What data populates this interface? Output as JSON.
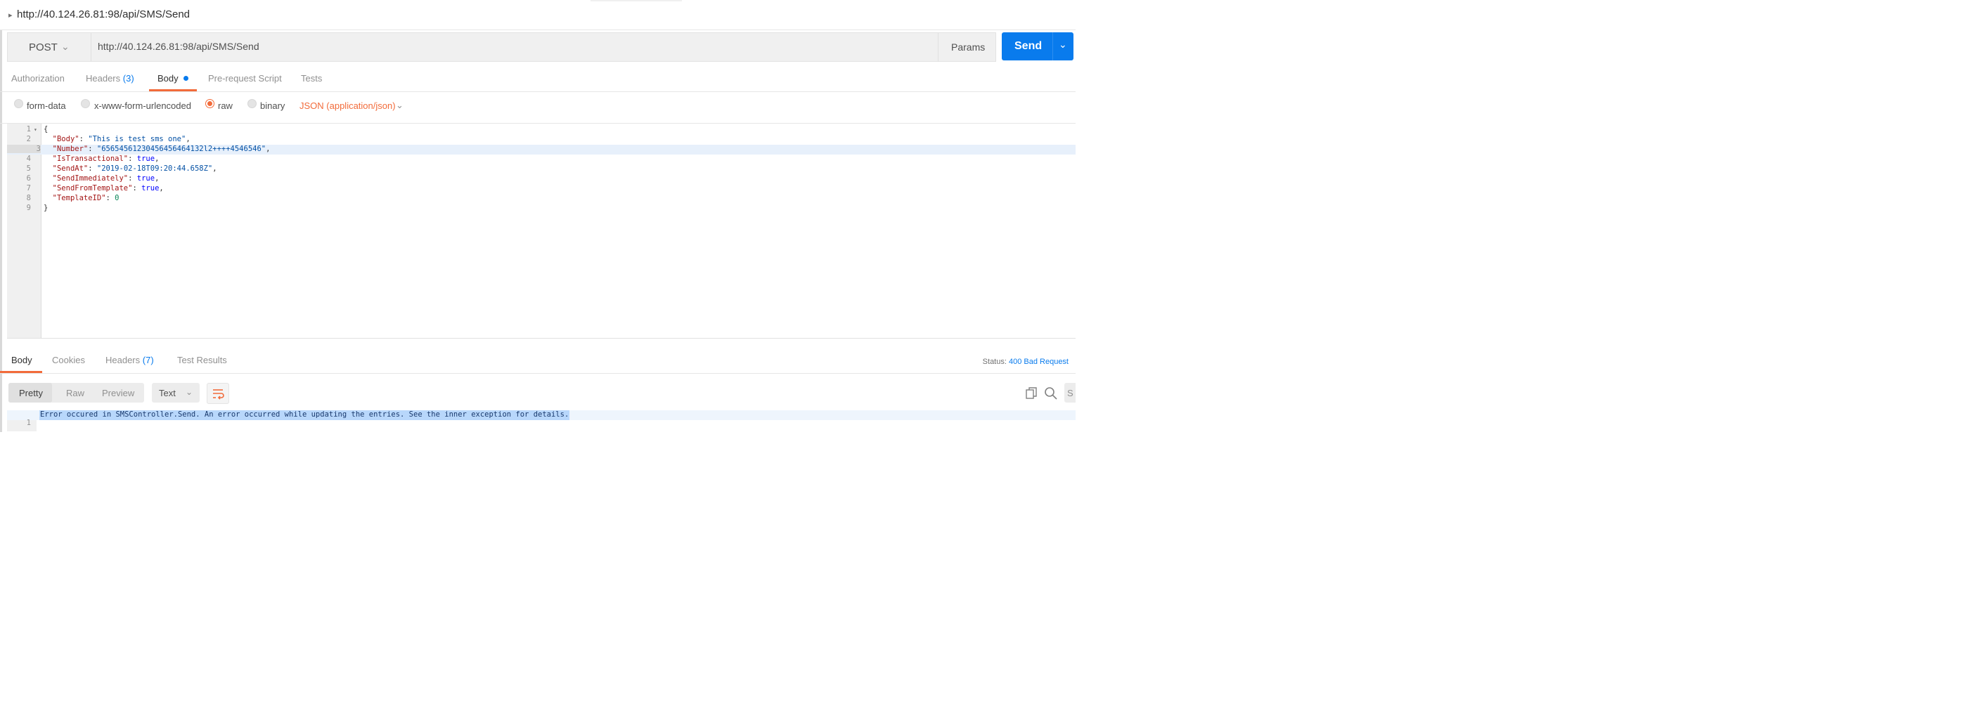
{
  "tab": {
    "title": "http://40.124.26.81:98/api/SMS/Send"
  },
  "request": {
    "method": "POST",
    "url": "http://40.124.26.81:98/api/SMS/Send",
    "params_label": "Params",
    "send_label": "Send"
  },
  "request_tabs": [
    {
      "label": "Authorization"
    },
    {
      "label": "Headers",
      "count": "(3)"
    },
    {
      "label": "Body"
    },
    {
      "label": "Pre-request Script"
    },
    {
      "label": "Tests"
    }
  ],
  "body_options": {
    "form_data": "form-data",
    "urlencoded": "x-www-form-urlencoded",
    "raw": "raw",
    "binary": "binary",
    "selected": "raw",
    "content_type": "JSON (application/json)"
  },
  "editor_lines": [
    {
      "num": "1",
      "text": "{"
    },
    {
      "num": "2",
      "text": "  \"Body\": \"This is test sms one\","
    },
    {
      "num": "3",
      "text": "  \"Number\": \"65654561230456456464132l2++++4546546\","
    },
    {
      "num": "4",
      "text": "  \"IsTransactional\": true,"
    },
    {
      "num": "5",
      "text": "  \"SendAt\": \"2019-02-18T09:20:44.658Z\","
    },
    {
      "num": "6",
      "text": "  \"SendImmediately\": true,"
    },
    {
      "num": "7",
      "text": "  \"SendFromTemplate\": true,"
    },
    {
      "num": "8",
      "text": "  \"TemplateID\": 0"
    },
    {
      "num": "9",
      "text": "}"
    }
  ],
  "response_tabs": [
    {
      "label": "Body"
    },
    {
      "label": "Cookies"
    },
    {
      "label": "Headers",
      "count": "(7)"
    },
    {
      "label": "Test Results"
    }
  ],
  "status": {
    "label": "Status:",
    "value": "400 Bad Request"
  },
  "response_view": {
    "pretty": "Pretty",
    "raw": "Raw",
    "preview": "Preview",
    "format": "Text",
    "save": "S"
  },
  "response_lines": [
    {
      "num": "1",
      "text": "Error occured in SMSController.Send. An error occurred while updating the entries. See the inner exception for details."
    }
  ],
  "colors": {
    "accent": "#f26b3a",
    "primary": "#097bed"
  }
}
